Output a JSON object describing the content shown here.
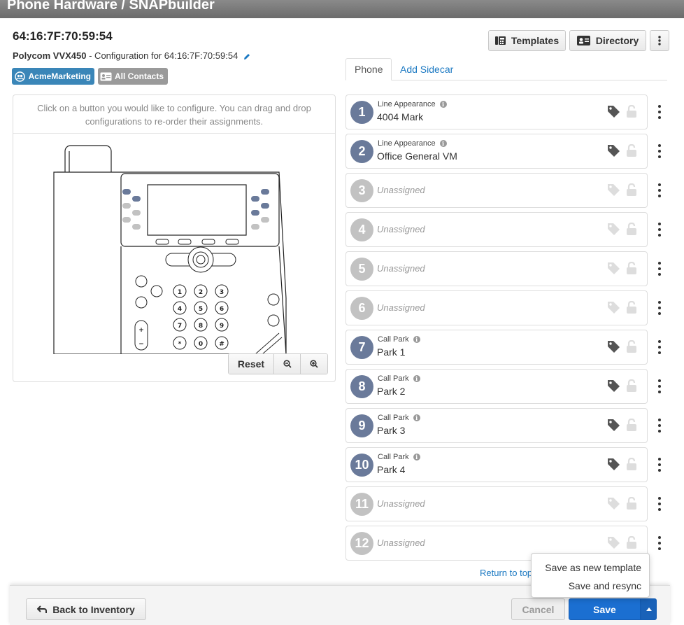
{
  "header": {
    "title": "Phone Hardware  /  SNAPbuilder"
  },
  "device": {
    "mac": "64:16:7F:70:59:54",
    "model": "Polycom VVX450",
    "config_text": " - Configuration for 64:16:7F:70:59:54"
  },
  "tags": {
    "acme": "AcmeMarketing",
    "contacts": "All Contacts"
  },
  "toolbar": {
    "templates": "Templates",
    "directory": "Directory"
  },
  "phone_panel": {
    "instructions": "Click on a button you would like to configure. You can drag and drop configurations to re-order their assignments.",
    "reset": "Reset"
  },
  "tabs": {
    "phone": "Phone",
    "sidecar": "Add Sidecar"
  },
  "lines": [
    {
      "num": "1",
      "type": "Line Appearance",
      "label": "4004 Mark",
      "assigned": true
    },
    {
      "num": "2",
      "type": "Line Appearance",
      "label": "Office General VM",
      "assigned": true
    },
    {
      "num": "3",
      "type": "",
      "label": "Unassigned",
      "assigned": false
    },
    {
      "num": "4",
      "type": "",
      "label": "Unassigned",
      "assigned": false
    },
    {
      "num": "5",
      "type": "",
      "label": "Unassigned",
      "assigned": false
    },
    {
      "num": "6",
      "type": "",
      "label": "Unassigned",
      "assigned": false
    },
    {
      "num": "7",
      "type": "Call Park",
      "label": "Park 1",
      "assigned": true
    },
    {
      "num": "8",
      "type": "Call Park",
      "label": "Park 2",
      "assigned": true
    },
    {
      "num": "9",
      "type": "Call Park",
      "label": "Park 3",
      "assigned": true
    },
    {
      "num": "10",
      "type": "Call Park",
      "label": "Park 4",
      "assigned": true
    },
    {
      "num": "11",
      "type": "",
      "label": "Unassigned",
      "assigned": false
    },
    {
      "num": "12",
      "type": "",
      "label": "Unassigned",
      "assigned": false
    }
  ],
  "return_top": "Return to top",
  "footer": {
    "back": "Back to Inventory",
    "cancel": "Cancel",
    "save": "Save",
    "save_menu": [
      "Save as new template",
      "Save and resync"
    ]
  },
  "colors": {
    "accent": "#1b6fd1",
    "assigned": "#6a7a9a",
    "unassigned": "#c2c2c2",
    "tag_acme": "#3a86b8"
  }
}
